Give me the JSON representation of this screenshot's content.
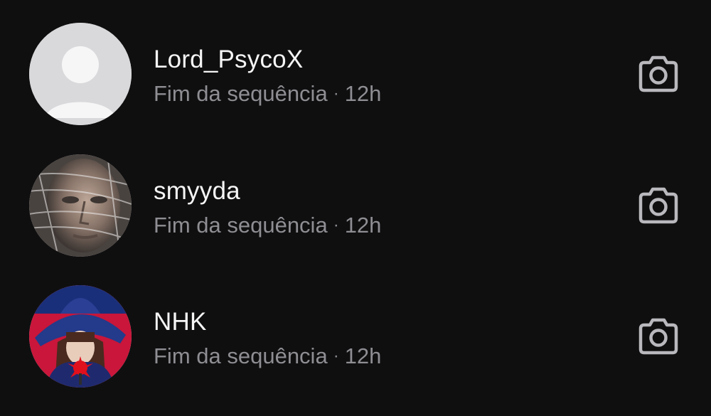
{
  "threads": [
    {
      "username": "Lord_PsycoX",
      "status": "Fim da sequência",
      "separator": "·",
      "time": "12h",
      "avatar": "default-avatar-icon",
      "action_icon": "camera-icon"
    },
    {
      "username": "smyyda",
      "status": "Fim da sequência",
      "separator": "·",
      "time": "12h",
      "avatar": "profile-photo-man-face-wrapped-in-plastic",
      "action_icon": "camera-icon"
    },
    {
      "username": "NHK",
      "status": "Fim da sequência",
      "separator": "·",
      "time": "12h",
      "avatar": "profile-photo-woman-in-witch-hat",
      "action_icon": "camera-icon"
    }
  ],
  "colors": {
    "background": "#0f0f10",
    "username": "#f5f5f5",
    "meta_text": "#8e8e93",
    "icon": "#b9b9bd"
  }
}
